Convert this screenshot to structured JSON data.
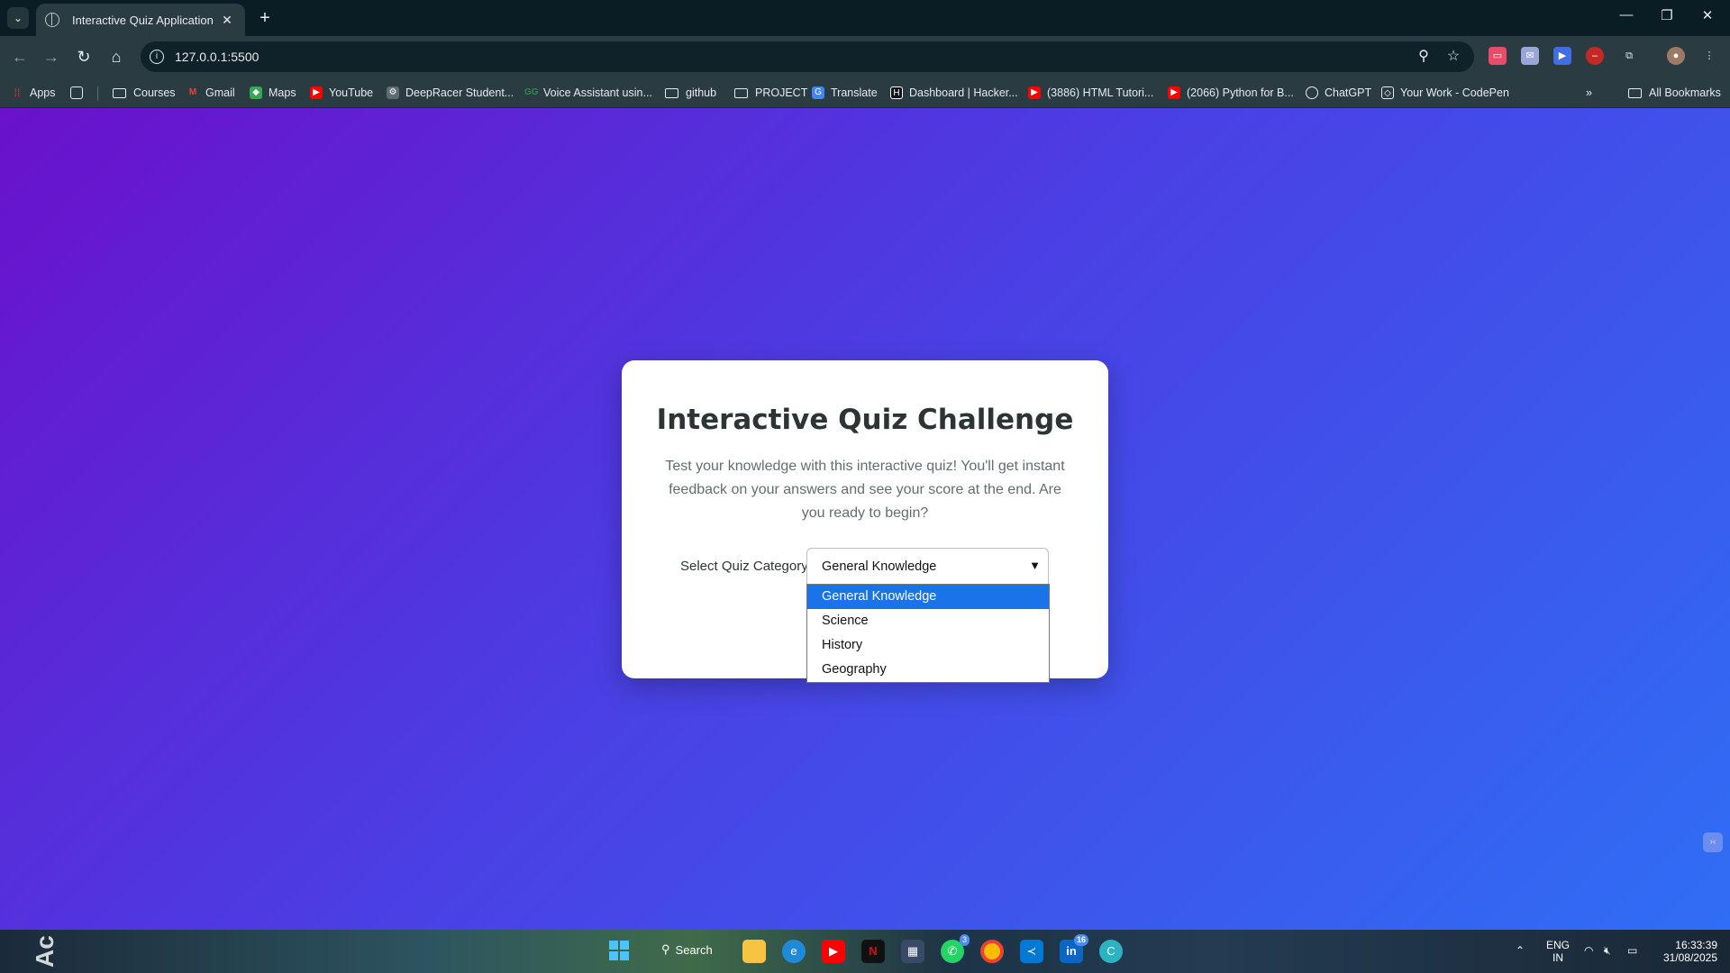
{
  "browser": {
    "tab_title": "Interactive Quiz Application",
    "url": "127.0.0.1:5500"
  },
  "bookmarks": [
    {
      "label": "Apps",
      "icon": "apps-grid-icon",
      "color": "#ea4335"
    },
    {
      "label": "Courses",
      "icon": "folder-icon"
    },
    {
      "label": "Gmail",
      "icon": "gmail-icon",
      "color": "#ea4335"
    },
    {
      "label": "Maps",
      "icon": "maps-icon",
      "color": "#34a853"
    },
    {
      "label": "YouTube",
      "icon": "youtube-icon",
      "color": "#ff0000"
    },
    {
      "label": "DeepRacer Student...",
      "icon": "deepracer-icon"
    },
    {
      "label": "Voice Assistant usin...",
      "icon": "gfg-icon",
      "color": "#2f8d46"
    },
    {
      "label": "github",
      "icon": "folder-icon"
    },
    {
      "label": "PROJECT",
      "icon": "folder-icon"
    },
    {
      "label": "Translate",
      "icon": "translate-icon",
      "color": "#4285f4"
    },
    {
      "label": "Dashboard | Hacker...",
      "icon": "hackerrank-icon"
    },
    {
      "label": "(3886) HTML Tutori...",
      "icon": "youtube-icon",
      "color": "#ff0000"
    },
    {
      "label": "(2066) Python for B...",
      "icon": "youtube-icon",
      "color": "#ff0000"
    },
    {
      "label": "ChatGPT",
      "icon": "chatgpt-icon"
    },
    {
      "label": "Your Work - CodePen",
      "icon": "codepen-icon"
    }
  ],
  "all_bookmarks": "All Bookmarks",
  "quiz": {
    "title": "Interactive Quiz Challenge",
    "description": "Test your knowledge with this interactive quiz! You'll get instant feedback on your answers and see your score at the end. Are you ready to begin?",
    "category_label": "Select Quiz Category:",
    "selected_category": "General Knowledge",
    "options": [
      "General Knowledge",
      "Science",
      "History",
      "Geography"
    ]
  },
  "taskbar": {
    "search_label": "Search",
    "whatsapp_badge": "3",
    "linkedin_badge": "16",
    "lang_top": "ENG",
    "lang_bottom": "IN",
    "time": "16:33:39",
    "date": "31/08/2025",
    "desktop_text": "Ac"
  }
}
